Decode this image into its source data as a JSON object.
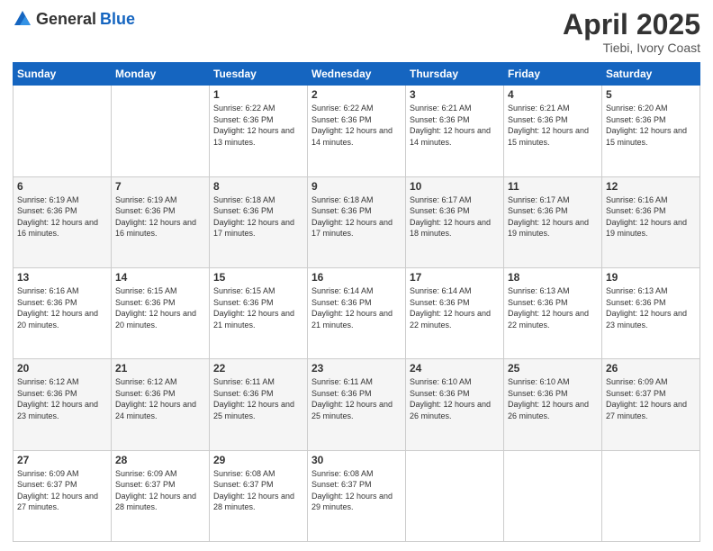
{
  "header": {
    "logo_general": "General",
    "logo_blue": "Blue",
    "title": "April 2025",
    "location": "Tiebi, Ivory Coast"
  },
  "days_of_week": [
    "Sunday",
    "Monday",
    "Tuesday",
    "Wednesday",
    "Thursday",
    "Friday",
    "Saturday"
  ],
  "weeks": [
    [
      {
        "day": "",
        "sunrise": "",
        "sunset": "",
        "daylight": ""
      },
      {
        "day": "",
        "sunrise": "",
        "sunset": "",
        "daylight": ""
      },
      {
        "day": "1",
        "sunrise": "Sunrise: 6:22 AM",
        "sunset": "Sunset: 6:36 PM",
        "daylight": "Daylight: 12 hours and 13 minutes."
      },
      {
        "day": "2",
        "sunrise": "Sunrise: 6:22 AM",
        "sunset": "Sunset: 6:36 PM",
        "daylight": "Daylight: 12 hours and 14 minutes."
      },
      {
        "day": "3",
        "sunrise": "Sunrise: 6:21 AM",
        "sunset": "Sunset: 6:36 PM",
        "daylight": "Daylight: 12 hours and 14 minutes."
      },
      {
        "day": "4",
        "sunrise": "Sunrise: 6:21 AM",
        "sunset": "Sunset: 6:36 PM",
        "daylight": "Daylight: 12 hours and 15 minutes."
      },
      {
        "day": "5",
        "sunrise": "Sunrise: 6:20 AM",
        "sunset": "Sunset: 6:36 PM",
        "daylight": "Daylight: 12 hours and 15 minutes."
      }
    ],
    [
      {
        "day": "6",
        "sunrise": "Sunrise: 6:19 AM",
        "sunset": "Sunset: 6:36 PM",
        "daylight": "Daylight: 12 hours and 16 minutes."
      },
      {
        "day": "7",
        "sunrise": "Sunrise: 6:19 AM",
        "sunset": "Sunset: 6:36 PM",
        "daylight": "Daylight: 12 hours and 16 minutes."
      },
      {
        "day": "8",
        "sunrise": "Sunrise: 6:18 AM",
        "sunset": "Sunset: 6:36 PM",
        "daylight": "Daylight: 12 hours and 17 minutes."
      },
      {
        "day": "9",
        "sunrise": "Sunrise: 6:18 AM",
        "sunset": "Sunset: 6:36 PM",
        "daylight": "Daylight: 12 hours and 17 minutes."
      },
      {
        "day": "10",
        "sunrise": "Sunrise: 6:17 AM",
        "sunset": "Sunset: 6:36 PM",
        "daylight": "Daylight: 12 hours and 18 minutes."
      },
      {
        "day": "11",
        "sunrise": "Sunrise: 6:17 AM",
        "sunset": "Sunset: 6:36 PM",
        "daylight": "Daylight: 12 hours and 19 minutes."
      },
      {
        "day": "12",
        "sunrise": "Sunrise: 6:16 AM",
        "sunset": "Sunset: 6:36 PM",
        "daylight": "Daylight: 12 hours and 19 minutes."
      }
    ],
    [
      {
        "day": "13",
        "sunrise": "Sunrise: 6:16 AM",
        "sunset": "Sunset: 6:36 PM",
        "daylight": "Daylight: 12 hours and 20 minutes."
      },
      {
        "day": "14",
        "sunrise": "Sunrise: 6:15 AM",
        "sunset": "Sunset: 6:36 PM",
        "daylight": "Daylight: 12 hours and 20 minutes."
      },
      {
        "day": "15",
        "sunrise": "Sunrise: 6:15 AM",
        "sunset": "Sunset: 6:36 PM",
        "daylight": "Daylight: 12 hours and 21 minutes."
      },
      {
        "day": "16",
        "sunrise": "Sunrise: 6:14 AM",
        "sunset": "Sunset: 6:36 PM",
        "daylight": "Daylight: 12 hours and 21 minutes."
      },
      {
        "day": "17",
        "sunrise": "Sunrise: 6:14 AM",
        "sunset": "Sunset: 6:36 PM",
        "daylight": "Daylight: 12 hours and 22 minutes."
      },
      {
        "day": "18",
        "sunrise": "Sunrise: 6:13 AM",
        "sunset": "Sunset: 6:36 PM",
        "daylight": "Daylight: 12 hours and 22 minutes."
      },
      {
        "day": "19",
        "sunrise": "Sunrise: 6:13 AM",
        "sunset": "Sunset: 6:36 PM",
        "daylight": "Daylight: 12 hours and 23 minutes."
      }
    ],
    [
      {
        "day": "20",
        "sunrise": "Sunrise: 6:12 AM",
        "sunset": "Sunset: 6:36 PM",
        "daylight": "Daylight: 12 hours and 23 minutes."
      },
      {
        "day": "21",
        "sunrise": "Sunrise: 6:12 AM",
        "sunset": "Sunset: 6:36 PM",
        "daylight": "Daylight: 12 hours and 24 minutes."
      },
      {
        "day": "22",
        "sunrise": "Sunrise: 6:11 AM",
        "sunset": "Sunset: 6:36 PM",
        "daylight": "Daylight: 12 hours and 25 minutes."
      },
      {
        "day": "23",
        "sunrise": "Sunrise: 6:11 AM",
        "sunset": "Sunset: 6:36 PM",
        "daylight": "Daylight: 12 hours and 25 minutes."
      },
      {
        "day": "24",
        "sunrise": "Sunrise: 6:10 AM",
        "sunset": "Sunset: 6:36 PM",
        "daylight": "Daylight: 12 hours and 26 minutes."
      },
      {
        "day": "25",
        "sunrise": "Sunrise: 6:10 AM",
        "sunset": "Sunset: 6:36 PM",
        "daylight": "Daylight: 12 hours and 26 minutes."
      },
      {
        "day": "26",
        "sunrise": "Sunrise: 6:09 AM",
        "sunset": "Sunset: 6:37 PM",
        "daylight": "Daylight: 12 hours and 27 minutes."
      }
    ],
    [
      {
        "day": "27",
        "sunrise": "Sunrise: 6:09 AM",
        "sunset": "Sunset: 6:37 PM",
        "daylight": "Daylight: 12 hours and 27 minutes."
      },
      {
        "day": "28",
        "sunrise": "Sunrise: 6:09 AM",
        "sunset": "Sunset: 6:37 PM",
        "daylight": "Daylight: 12 hours and 28 minutes."
      },
      {
        "day": "29",
        "sunrise": "Sunrise: 6:08 AM",
        "sunset": "Sunset: 6:37 PM",
        "daylight": "Daylight: 12 hours and 28 minutes."
      },
      {
        "day": "30",
        "sunrise": "Sunrise: 6:08 AM",
        "sunset": "Sunset: 6:37 PM",
        "daylight": "Daylight: 12 hours and 29 minutes."
      },
      {
        "day": "",
        "sunrise": "",
        "sunset": "",
        "daylight": ""
      },
      {
        "day": "",
        "sunrise": "",
        "sunset": "",
        "daylight": ""
      },
      {
        "day": "",
        "sunrise": "",
        "sunset": "",
        "daylight": ""
      }
    ]
  ]
}
